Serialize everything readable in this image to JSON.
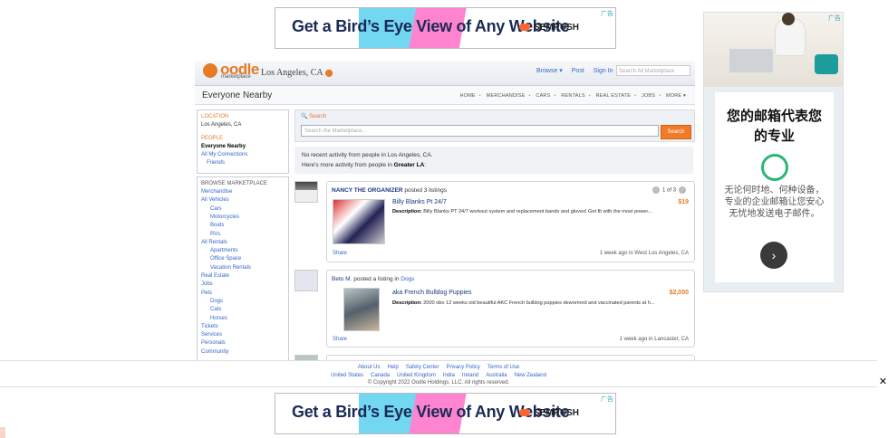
{
  "ads": {
    "banner_text": "Get a Bird’s Eye View of Any Website",
    "banner_brand": "SEMRUSH",
    "ad_badge": "广告",
    "right_title": "您的邮箱代表您的专业",
    "right_body": "无论何时地、何种设备，专业的企业邮箱让您安心无忧地发送电子邮件。",
    "right_arrow": "›"
  },
  "header": {
    "logo": "oodle",
    "logo_sub": "marketplace",
    "location": "Los Angeles, CA",
    "nav": [
      "Browse ▾",
      "Post",
      "Sign In"
    ],
    "search_placeholder": "Search All Marketplace"
  },
  "subheader": {
    "title": "Everyone Nearby",
    "categories": [
      "HOME",
      "MERCHANDISE",
      "CARS",
      "RENTALS",
      "REAL ESTATE",
      "JOBS",
      "MORE ▾"
    ]
  },
  "sidebar": {
    "location_heading": "LOCATION",
    "location_value": "Los Angeles, CA",
    "people_heading": "PEOPLE",
    "people_items": [
      "Everyone Nearby",
      "All My Connections",
      "Friends"
    ],
    "browse_heading": "BROWSE MARKETPLACE",
    "browse_items": [
      {
        "label": "Merchandise",
        "level": 0
      },
      {
        "label": "All Vehicles",
        "level": 0
      },
      {
        "label": "Cars",
        "level": 1
      },
      {
        "label": "Motorcycles",
        "level": 1
      },
      {
        "label": "Boats",
        "level": 1
      },
      {
        "label": "RVs",
        "level": 1
      },
      {
        "label": "All Rentals",
        "level": 0
      },
      {
        "label": "Apartments",
        "level": 1
      },
      {
        "label": "Office Space",
        "level": 1
      },
      {
        "label": "Vacation Rentals",
        "level": 1
      },
      {
        "label": "Real Estate",
        "level": 0
      },
      {
        "label": "Jobs",
        "level": 0
      },
      {
        "label": "Pets",
        "level": 0
      },
      {
        "label": "Dogs",
        "level": 1
      },
      {
        "label": "Cats",
        "level": 1
      },
      {
        "label": "Horses",
        "level": 1
      },
      {
        "label": "Tickets",
        "level": 0
      },
      {
        "label": "Services",
        "level": 0
      },
      {
        "label": "Personals",
        "level": 0
      },
      {
        "label": "Community",
        "level": 0
      }
    ]
  },
  "search": {
    "label": "Search",
    "placeholder": "Search the Marketplace...",
    "button": "Search"
  },
  "notice": {
    "line1": "No recent activity from people in Los Angeles, CA.",
    "line2_prefix": "Here's more activity from people in ",
    "line2_place": "Greater LA",
    "line2_suffix": ":"
  },
  "listings": [
    {
      "poster": "NANCY THE ORGANIZER",
      "action": " posted 3 listings",
      "pager": "1 of 3",
      "title": "Billy Blanks Pt 24/7",
      "price": "$19",
      "desc_label": "Description:",
      "desc": " Billy Blanks PT 24/7 workout system and replacement bands and gloves! Get fit with the most power...",
      "share": "Share",
      "time": "1 week ago in West Los Angeles, CA"
    },
    {
      "poster": "Beto M.",
      "action": " posted a listing in ",
      "category": "Dogs",
      "title": "aka French Bulldog Puppies",
      "price": "$2,000",
      "desc_label": "Description:",
      "desc": " 2000 obo 12 weeks old beautiful AKC French bulldog puppies dewormed and vaccinated parents at h...",
      "share": "Share",
      "time": "1 week ago in Lancaster, CA"
    }
  ],
  "footer": {
    "links1": [
      "About Us",
      "Help",
      "Safety Center",
      "Privacy Policy",
      "Terms of Use"
    ],
    "links2": [
      "United States",
      "Canada",
      "United Kingdom",
      "India",
      "Ireland",
      "Australia",
      "New Zealand"
    ],
    "copyright": "© Copyright 2022 Oodle Holdings, LLC. All rights reserved."
  }
}
